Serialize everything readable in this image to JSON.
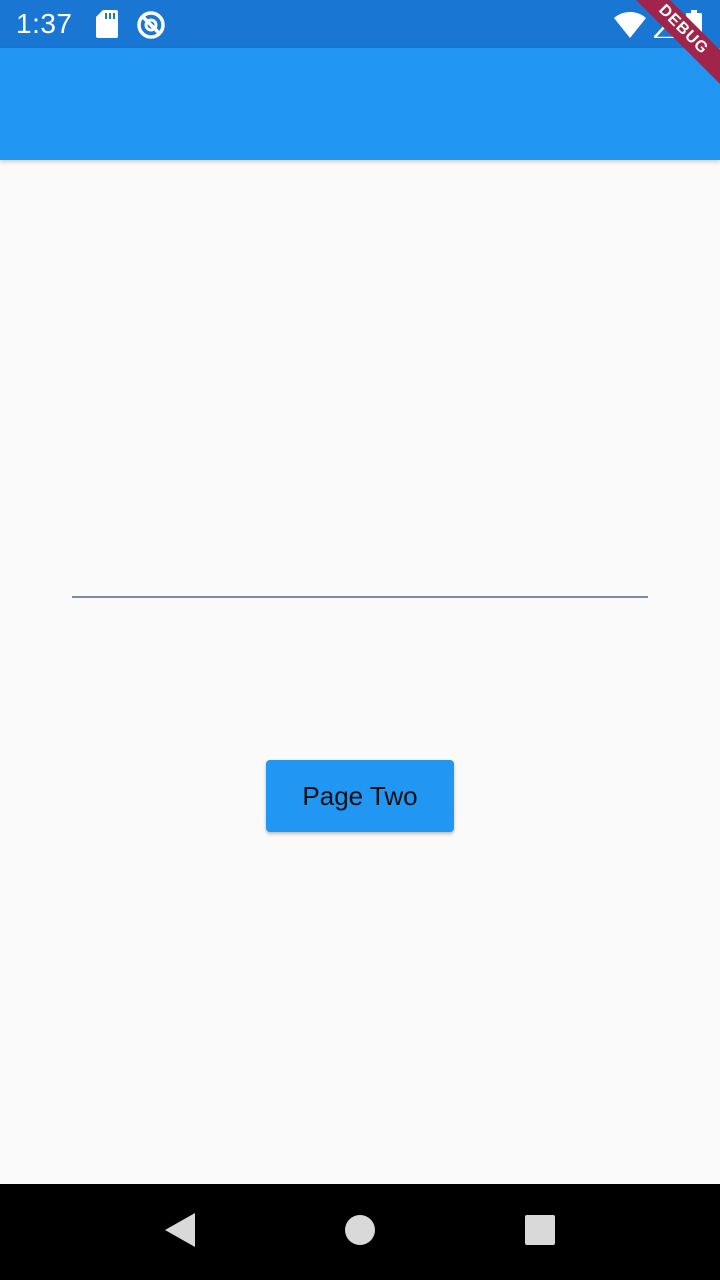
{
  "status_bar": {
    "time": "1:37",
    "icons": [
      "sd-card-icon",
      "sync-disabled-icon",
      "wifi-icon",
      "signal-icon",
      "battery-icon"
    ],
    "background": "#1976d2"
  },
  "app_bar": {
    "background": "#2196f3"
  },
  "debug_banner": {
    "label": "DEBUG",
    "color": "#a1244a"
  },
  "main": {
    "text_field": {
      "value": "",
      "placeholder": ""
    },
    "page_two_button": {
      "label": "Page Two"
    }
  },
  "nav_bar": {
    "buttons": [
      "back-icon",
      "home-icon",
      "recents-icon"
    ]
  }
}
